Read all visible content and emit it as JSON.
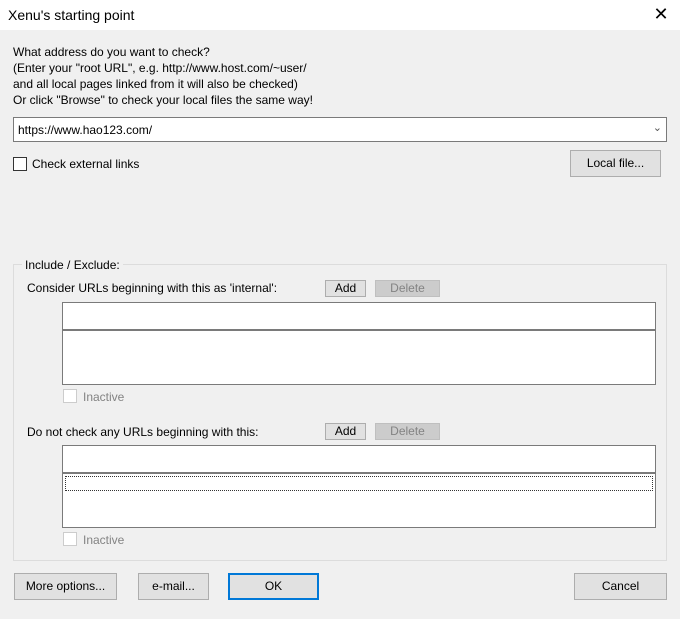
{
  "window": {
    "title": "Xenu's starting point",
    "close_icon": "close-icon"
  },
  "intro": {
    "lines": [
      "What address do you want to check?",
      "(Enter your \"root URL\", e.g. http://www.host.com/~user/",
      "and all local pages linked from it will also be checked)",
      "Or click \"Browse\" to check your local files the same way!"
    ]
  },
  "url": {
    "value": "https://www.hao123.com/"
  },
  "check_external": {
    "label": "Check external links",
    "checked": false
  },
  "local_file_button": "Local file...",
  "group": {
    "legend": "Include / Exclude:",
    "internal": {
      "label": "Consider URLs beginning with this as 'internal':",
      "add": "Add",
      "delete": "Delete",
      "input": "",
      "inactive": "Inactive"
    },
    "exclude": {
      "label": "Do not check any URLs beginning with this:",
      "add": "Add",
      "delete": "Delete",
      "input": "",
      "inactive": "Inactive"
    }
  },
  "buttons": {
    "more_options": "More options...",
    "email": "e-mail...",
    "ok": "OK",
    "cancel": "Cancel"
  }
}
